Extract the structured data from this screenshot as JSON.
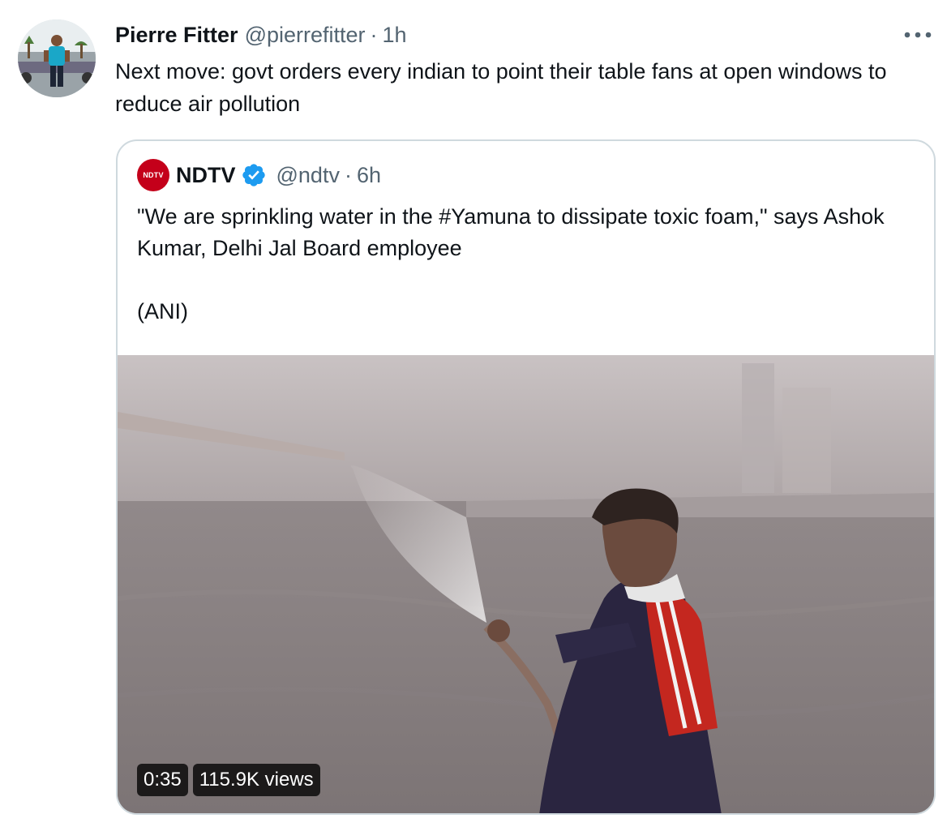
{
  "author": {
    "display_name": "Pierre Fitter",
    "handle": "@pierrefitter",
    "separator": "·",
    "time": "1h"
  },
  "tweet": {
    "text": "Next move: govt orders every indian to point their table fans at open windows to reduce air pollution"
  },
  "more_icon": "more-horizontal-icon",
  "quoted": {
    "logo_text": "NDTV",
    "display_name": "NDTV",
    "verified_icon": "verified-badge-icon",
    "handle": "@ndtv",
    "separator": "·",
    "time": "6h",
    "text_line1": "\"We are sprinkling water in the #Yamuna to dissipate toxic foam,\" says Ashok Kumar, Delhi Jal Board employee",
    "text_line2": "(ANI)",
    "video": {
      "duration": "0:35",
      "views": "115.9K views"
    }
  },
  "colors": {
    "text_primary": "#0f1419",
    "text_secondary": "#536471",
    "border": "#cfd9de",
    "verified_blue": "#1d9bf0",
    "ndtv_red": "#c4001a"
  }
}
